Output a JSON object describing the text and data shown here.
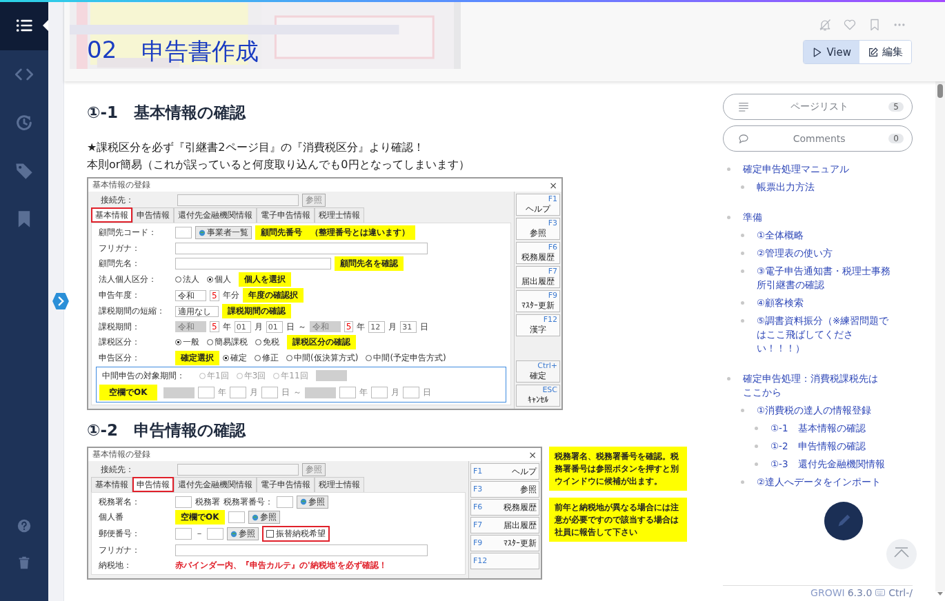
{
  "nav": {
    "items": [
      {
        "kind": "menu",
        "selected": true
      },
      {
        "kind": "code",
        "selected": false
      },
      {
        "kind": "history",
        "selected": false
      },
      {
        "kind": "tag",
        "selected": false
      },
      {
        "kind": "bookmark",
        "selected": false
      }
    ],
    "bottom": [
      {
        "kind": "help"
      },
      {
        "kind": "trash"
      }
    ]
  },
  "header": {
    "title_number": "02",
    "title": "申告書作成",
    "actions": [
      {
        "kind": "bell-off"
      },
      {
        "kind": "heart"
      },
      {
        "kind": "bookmark"
      },
      {
        "kind": "more"
      }
    ],
    "modes": [
      {
        "label": "View",
        "kind": "view",
        "selected": true
      },
      {
        "label": "編集",
        "kind": "edit",
        "selected": false
      }
    ]
  },
  "content": [
    {
      "kind": "heading",
      "text": "①-1　基本情報の確認"
    },
    {
      "kind": "paragraph",
      "lines": [
        "★課税区分を必ず『引継書2ページ目』の『消費税区分』より確認！",
        "本則or簡易（これが誤っていると何度取り込んでも0円となってしまいます）"
      ]
    },
    {
      "kind": "dialog",
      "title": "基本情報の登録",
      "close": "×",
      "connection": "接続先：",
      "connection_button": "参照",
      "tabs": [
        {
          "label": "基本情報",
          "selected": true,
          "highlighted": true
        },
        {
          "label": "申告情報",
          "selected": false,
          "highlighted": false
        },
        {
          "label": "還付先金融機関情報",
          "selected": false,
          "highlighted": false
        },
        {
          "label": "電子申告情報",
          "selected": false,
          "highlighted": false
        },
        {
          "label": "税理士情報",
          "selected": false,
          "highlighted": false
        }
      ],
      "rows": [
        {
          "label": "顧問先コード：",
          "controls": [
            {
              "kind": "field"
            },
            {
              "kind": "button",
              "label": "事業者一覧"
            }
          ],
          "note": "顧問先番号　（整理番号とは違います）"
        },
        {
          "label": "フリガナ：",
          "controls": [
            {
              "kind": "longfield"
            }
          ]
        },
        {
          "label": "顧問先名：",
          "controls": [
            {
              "kind": "widefield"
            }
          ],
          "note": "顧問先名を確認"
        },
        {
          "label": "法人個人区分：",
          "controls": [
            {
              "kind": "radio",
              "label": "法人",
              "selected": false,
              "disabled": false
            },
            {
              "kind": "radio",
              "label": "個人",
              "selected": true,
              "disabled": false
            }
          ],
          "note": "個人を選択"
        },
        {
          "label": "申告年度：",
          "controls": [
            {
              "kind": "select",
              "value": "令和",
              "disabled": false
            },
            {
              "kind": "spin",
              "value": "5"
            },
            {
              "kind": "text",
              "text": "年分"
            }
          ],
          "note": "年度の確認択"
        },
        {
          "label": "課税期間の短縮：",
          "controls": [
            {
              "kind": "select",
              "value": "適用なし",
              "disabled": false
            }
          ],
          "note": "課税期間の確認"
        },
        {
          "label": "課税期間：",
          "controls": [
            {
              "kind": "select",
              "value": "令和",
              "disabled": true
            },
            {
              "kind": "spin",
              "value": "5"
            },
            {
              "kind": "text",
              "text": "年"
            },
            {
              "kind": "field",
              "value": "01"
            },
            {
              "kind": "text",
              "text": "月"
            },
            {
              "kind": "field",
              "value": "01"
            },
            {
              "kind": "text",
              "text": "日"
            },
            {
              "kind": "text",
              "text": "～"
            },
            {
              "kind": "select",
              "value": "令和",
              "disabled": true
            },
            {
              "kind": "spin",
              "value": "5"
            },
            {
              "kind": "text",
              "text": "年"
            },
            {
              "kind": "field",
              "value": "12"
            },
            {
              "kind": "text",
              "text": "月"
            },
            {
              "kind": "field",
              "value": "31"
            },
            {
              "kind": "text",
              "text": "日"
            }
          ]
        },
        {
          "label": "課税区分：",
          "controls": [
            {
              "kind": "radio",
              "label": "一般",
              "selected": true,
              "disabled": false
            },
            {
              "kind": "radio",
              "label": "簡易課税",
              "selected": false,
              "disabled": false
            },
            {
              "kind": "radio",
              "label": "免税",
              "selected": false,
              "disabled": false
            }
          ],
          "note": "課税区分の確認"
        },
        {
          "label": "申告区分：",
          "note_first": "確定選択",
          "controls": [
            {
              "kind": "radio",
              "label": "確定",
              "selected": true,
              "disabled": false
            },
            {
              "kind": "radio",
              "label": "修正",
              "selected": false,
              "disabled": false
            },
            {
              "kind": "radio",
              "label": "中間(仮決算方式)",
              "selected": false,
              "disabled": false
            },
            {
              "kind": "radio",
              "label": "中間(予定申告方式)",
              "selected": false,
              "disabled": false
            }
          ]
        }
      ],
      "group": {
        "label": "中間申告の対象期間：",
        "options": [
          {
            "label": "年1回",
            "selected": false,
            "disabled": true
          },
          {
            "label": "年3回",
            "selected": false,
            "disabled": true
          },
          {
            "label": "年11回",
            "selected": false,
            "disabled": true
          }
        ],
        "note": "空欄でOK",
        "units": [
          "年",
          "月",
          "日",
          "～",
          "年",
          "月",
          "日"
        ]
      },
      "side_buttons": [
        {
          "key": "F1",
          "label": "ヘルプ"
        },
        {
          "key": "F3",
          "label": "参照"
        },
        {
          "key": "F6",
          "label": "税務履歴"
        },
        {
          "key": "F7",
          "label": "届出履歴"
        },
        {
          "key": "F9",
          "label": "ﾏｽﾀｰ更新"
        },
        {
          "key": "F12",
          "label": "漢字"
        },
        {
          "key": "Ctrl+",
          "label": "確定"
        },
        {
          "key": "ESC",
          "label": "ｷｬﾝｾﾙ"
        }
      ]
    },
    {
      "kind": "heading",
      "text": "①-2　申告情報の確認"
    },
    {
      "kind": "dialog2",
      "title": "基本情報の登録",
      "close": "×",
      "connection": "接続先：",
      "connection_button": "参照",
      "tabs": [
        {
          "label": "基本情報",
          "selected": false,
          "highlighted": false
        },
        {
          "label": "申告情報",
          "selected": true,
          "highlighted": true
        },
        {
          "label": "還付先金融機関情報",
          "selected": false,
          "highlighted": false
        },
        {
          "label": "電子申告情報",
          "selected": false,
          "highlighted": false
        },
        {
          "label": "税理士情報",
          "selected": false,
          "highlighted": false
        }
      ],
      "rows": [
        {
          "label": "税務署名：",
          "controls": [
            {
              "kind": "field"
            },
            {
              "kind": "text",
              "text": "税務署"
            },
            {
              "kind": "text",
              "text": "税務署番号："
            },
            {
              "kind": "field"
            },
            {
              "kind": "button",
              "label": "参照"
            }
          ]
        },
        {
          "label": "個人番",
          "note_first": "空欄でOK",
          "controls": [
            {
              "kind": "field"
            },
            {
              "kind": "button",
              "label": "参照"
            }
          ]
        },
        {
          "label": "郵便番号：",
          "controls": [
            {
              "kind": "field"
            },
            {
              "kind": "text",
              "text": "－"
            },
            {
              "kind": "field"
            },
            {
              "kind": "button",
              "label": "参照"
            },
            {
              "kind": "checkbox",
              "label": "振替納税希望",
              "checked": false,
              "highlighted": true
            }
          ]
        },
        {
          "label": "フリガナ：",
          "controls": [
            {
              "kind": "longfield"
            }
          ]
        },
        {
          "label": "納税地：",
          "controls": [],
          "warning": "赤バインダー内、『申告カルテ』の'納税地'を必ず確認！"
        }
      ],
      "notes": [
        "税務署名、税務署番号を確認。税務署番号は参照ボタンを押すと別ウインドウに候補が出ます。",
        "前年と納税地が異なる場合には注意が必要ですので該当する場合は社員に報告して下さい"
      ],
      "side_buttons": [
        {
          "key": "F1",
          "label": "ヘルプ"
        },
        {
          "key": "F3",
          "label": "参照"
        },
        {
          "key": "F6",
          "label": "税務履歴"
        },
        {
          "key": "F7",
          "label": "届出履歴"
        },
        {
          "key": "F9",
          "label": "ﾏｽﾀｰ更新"
        },
        {
          "key": "F12"
        }
      ]
    }
  ],
  "sidebar": {
    "buttons": [
      {
        "kind": "list",
        "label": "ページリスト",
        "count": "5"
      },
      {
        "kind": "comments",
        "label": "Comments",
        "count": "0"
      }
    ],
    "toc": [
      {
        "text": "確定申告処理マニュアル",
        "children": [
          {
            "text": "帳票出力方法"
          }
        ]
      },
      {
        "text": "準備",
        "children": [
          {
            "text": "①全体概略"
          },
          {
            "text": "②管理表の使い方"
          },
          {
            "text": "③電子申告通知書・税理士事務所引継書の確認"
          },
          {
            "text": "④顧客検索"
          },
          {
            "text": "⑤調書資料振分（※練習問題ではここ飛ばしてください！！！）"
          }
        ]
      },
      {
        "text": "確定申告処理：消費税課税先はここから",
        "children": [
          {
            "text": "①消費税の達人の情報登録",
            "children": [
              {
                "text": "①-1　基本情報の確認"
              },
              {
                "text": "①-2　申告情報の確認"
              },
              {
                "text": "①-3　還付先金融機関情報"
              }
            ]
          },
          {
            "text": "②達人へデータをインポート"
          }
        ]
      }
    ]
  },
  "footer": {
    "brand": "GROWI",
    "version": "6.3.0",
    "shortcut": "Ctrl-/"
  }
}
